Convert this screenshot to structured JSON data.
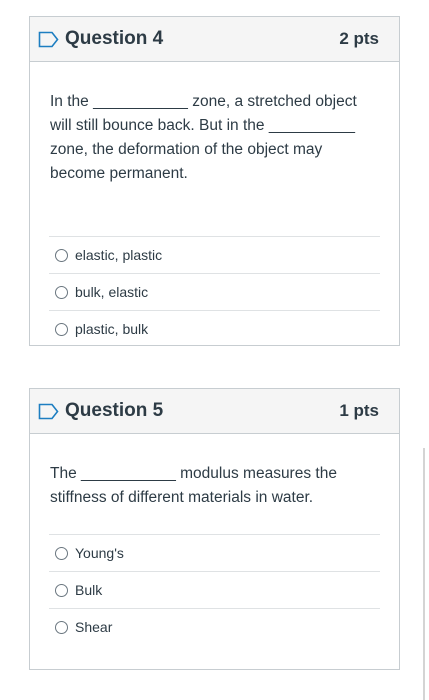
{
  "questions": [
    {
      "title": "Question 4",
      "points": "2 pts",
      "text": "In the ___________ zone, a stretched object will still bounce back. But in the __________ zone, the deformation of the object may become permanent.",
      "answers": [
        "elastic, plastic",
        "bulk, elastic",
        "plastic, bulk"
      ]
    },
    {
      "title": "Question 5",
      "points": "1 pts",
      "text": "The ___________ modulus measures the stiffness of different materials in water.",
      "answers": [
        "Young's",
        "Bulk",
        "Shear"
      ]
    }
  ],
  "colors": {
    "border": "#c7cdd1",
    "header_bg": "#f5f5f5",
    "text": "#2d3b45",
    "flag": "#1d7ec1"
  },
  "icons": {
    "question_flag": "flag-icon",
    "answer_radio": "radio-icon"
  }
}
